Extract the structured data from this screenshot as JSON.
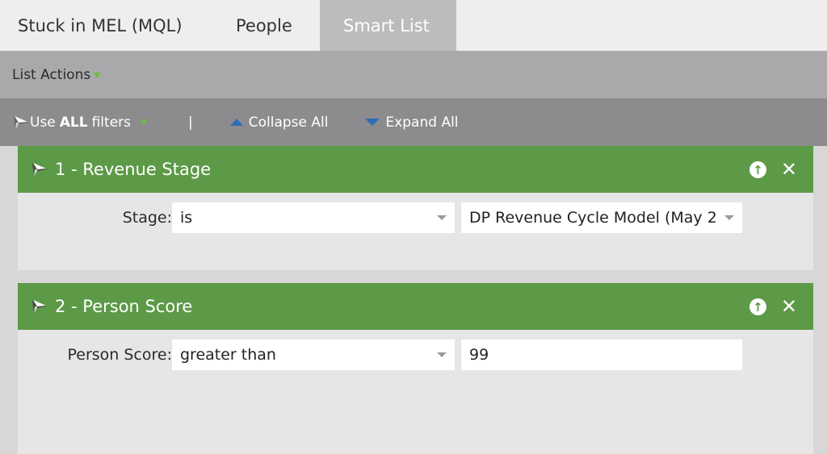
{
  "tabs": [
    {
      "label": "Stuck in MEL (MQL)"
    },
    {
      "label": "People"
    },
    {
      "label": "Smart List",
      "active": true
    }
  ],
  "list_actions": {
    "label": "List Actions"
  },
  "filter_bar": {
    "use_prefix": "Use",
    "use_bold": "ALL",
    "use_suffix": "filters",
    "separator": "|",
    "collapse_label": "Collapse All",
    "expand_label": "Expand All"
  },
  "filters": [
    {
      "title": "1 - Revenue Stage",
      "field_label": "Stage:",
      "operator": "is",
      "value": "DP Revenue Cycle Model (May 2"
    },
    {
      "title": "2 - Person Score",
      "field_label": "Person Score:",
      "operator": "greater than",
      "value": "99"
    }
  ],
  "icons": {
    "filter": "funnel-icon",
    "move_up": "arrow-up-circle-icon",
    "remove": "close-icon"
  },
  "colors": {
    "header_green": "#5c9a47",
    "active_tab": "#bcbcbd",
    "accent_blue": "#2f6db5"
  }
}
